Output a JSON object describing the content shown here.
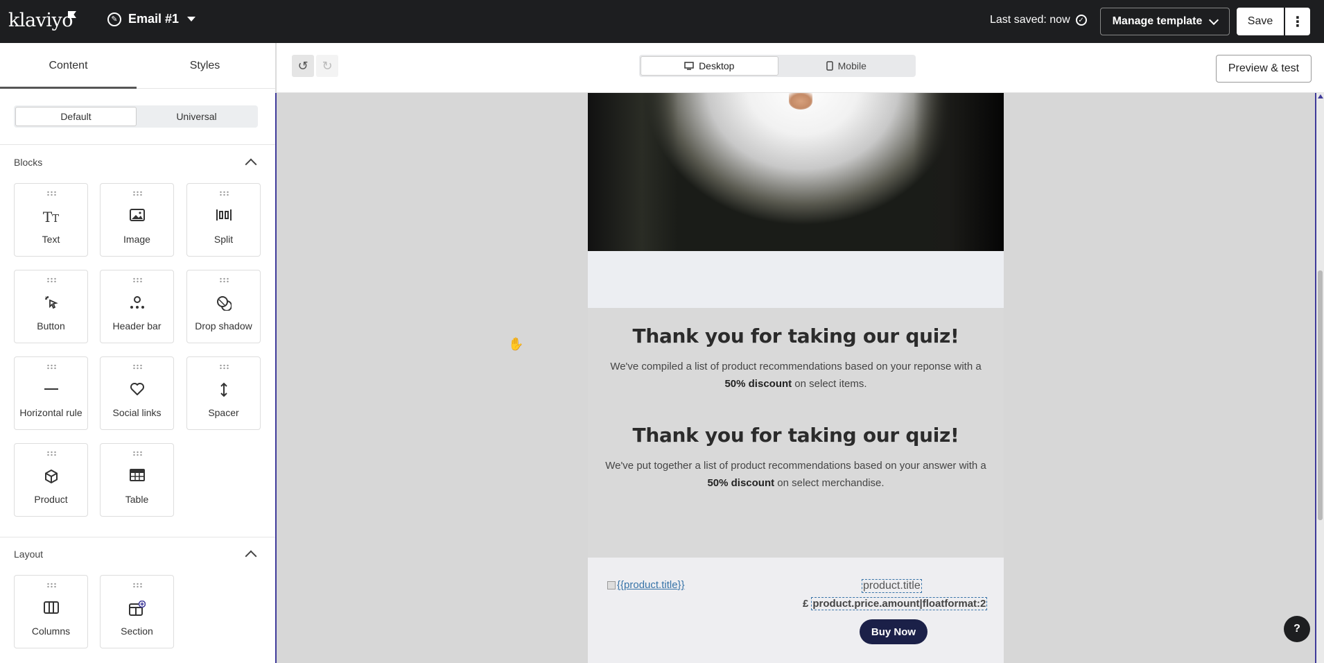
{
  "topbar": {
    "logo": "klaviyo",
    "email_name": "Email #1",
    "last_saved": "Last saved: now",
    "manage_template": "Manage template",
    "save": "Save",
    "more": "⋮"
  },
  "left_panel": {
    "tabs": [
      {
        "label": "Content",
        "active": true
      },
      {
        "label": "Styles",
        "active": false
      }
    ],
    "scope": {
      "default": "Default",
      "universal": "Universal",
      "selected": "Default"
    },
    "blocks_heading": "Blocks",
    "blocks": [
      {
        "label": "Text",
        "icon": "text-icon"
      },
      {
        "label": "Image",
        "icon": "image-icon"
      },
      {
        "label": "Split",
        "icon": "split-icon"
      },
      {
        "label": "Button",
        "icon": "button-icon"
      },
      {
        "label": "Header bar",
        "icon": "header-bar-icon"
      },
      {
        "label": "Drop shadow",
        "icon": "drop-shadow-icon"
      },
      {
        "label": "Horizontal rule",
        "icon": "horizontal-rule-icon"
      },
      {
        "label": "Social links",
        "icon": "heart-icon"
      },
      {
        "label": "Spacer",
        "icon": "spacer-icon"
      },
      {
        "label": "Product",
        "icon": "cube-icon"
      },
      {
        "label": "Table",
        "icon": "table-icon"
      }
    ],
    "layout_heading": "Layout",
    "layout": [
      {
        "label": "Columns",
        "icon": "columns-icon"
      },
      {
        "label": "Section",
        "icon": "section-icon"
      }
    ]
  },
  "toolbar": {
    "desktop": "Desktop",
    "mobile": "Mobile",
    "selected_device": "Desktop",
    "preview": "Preview & test"
  },
  "email": {
    "heading1": "Thank you for taking our quiz!",
    "para1_pre": "We've compiled a list of product recommendations based on your reponse with a ",
    "para1_bold": "50% discount",
    "para1_post": " on select items.",
    "heading2": "Thank you for taking our quiz!",
    "para2_pre": "We've put together a list of product recommendations based on your answer with a ",
    "para2_bold": "50% discount",
    "para2_post": " on select merchandise.",
    "product_image_alt": "{{product.title}}",
    "product_title": "product.title",
    "currency": "£",
    "product_price": "product.price.amount|floatformat:2",
    "buy_button": "Buy Now"
  },
  "help": "?"
}
